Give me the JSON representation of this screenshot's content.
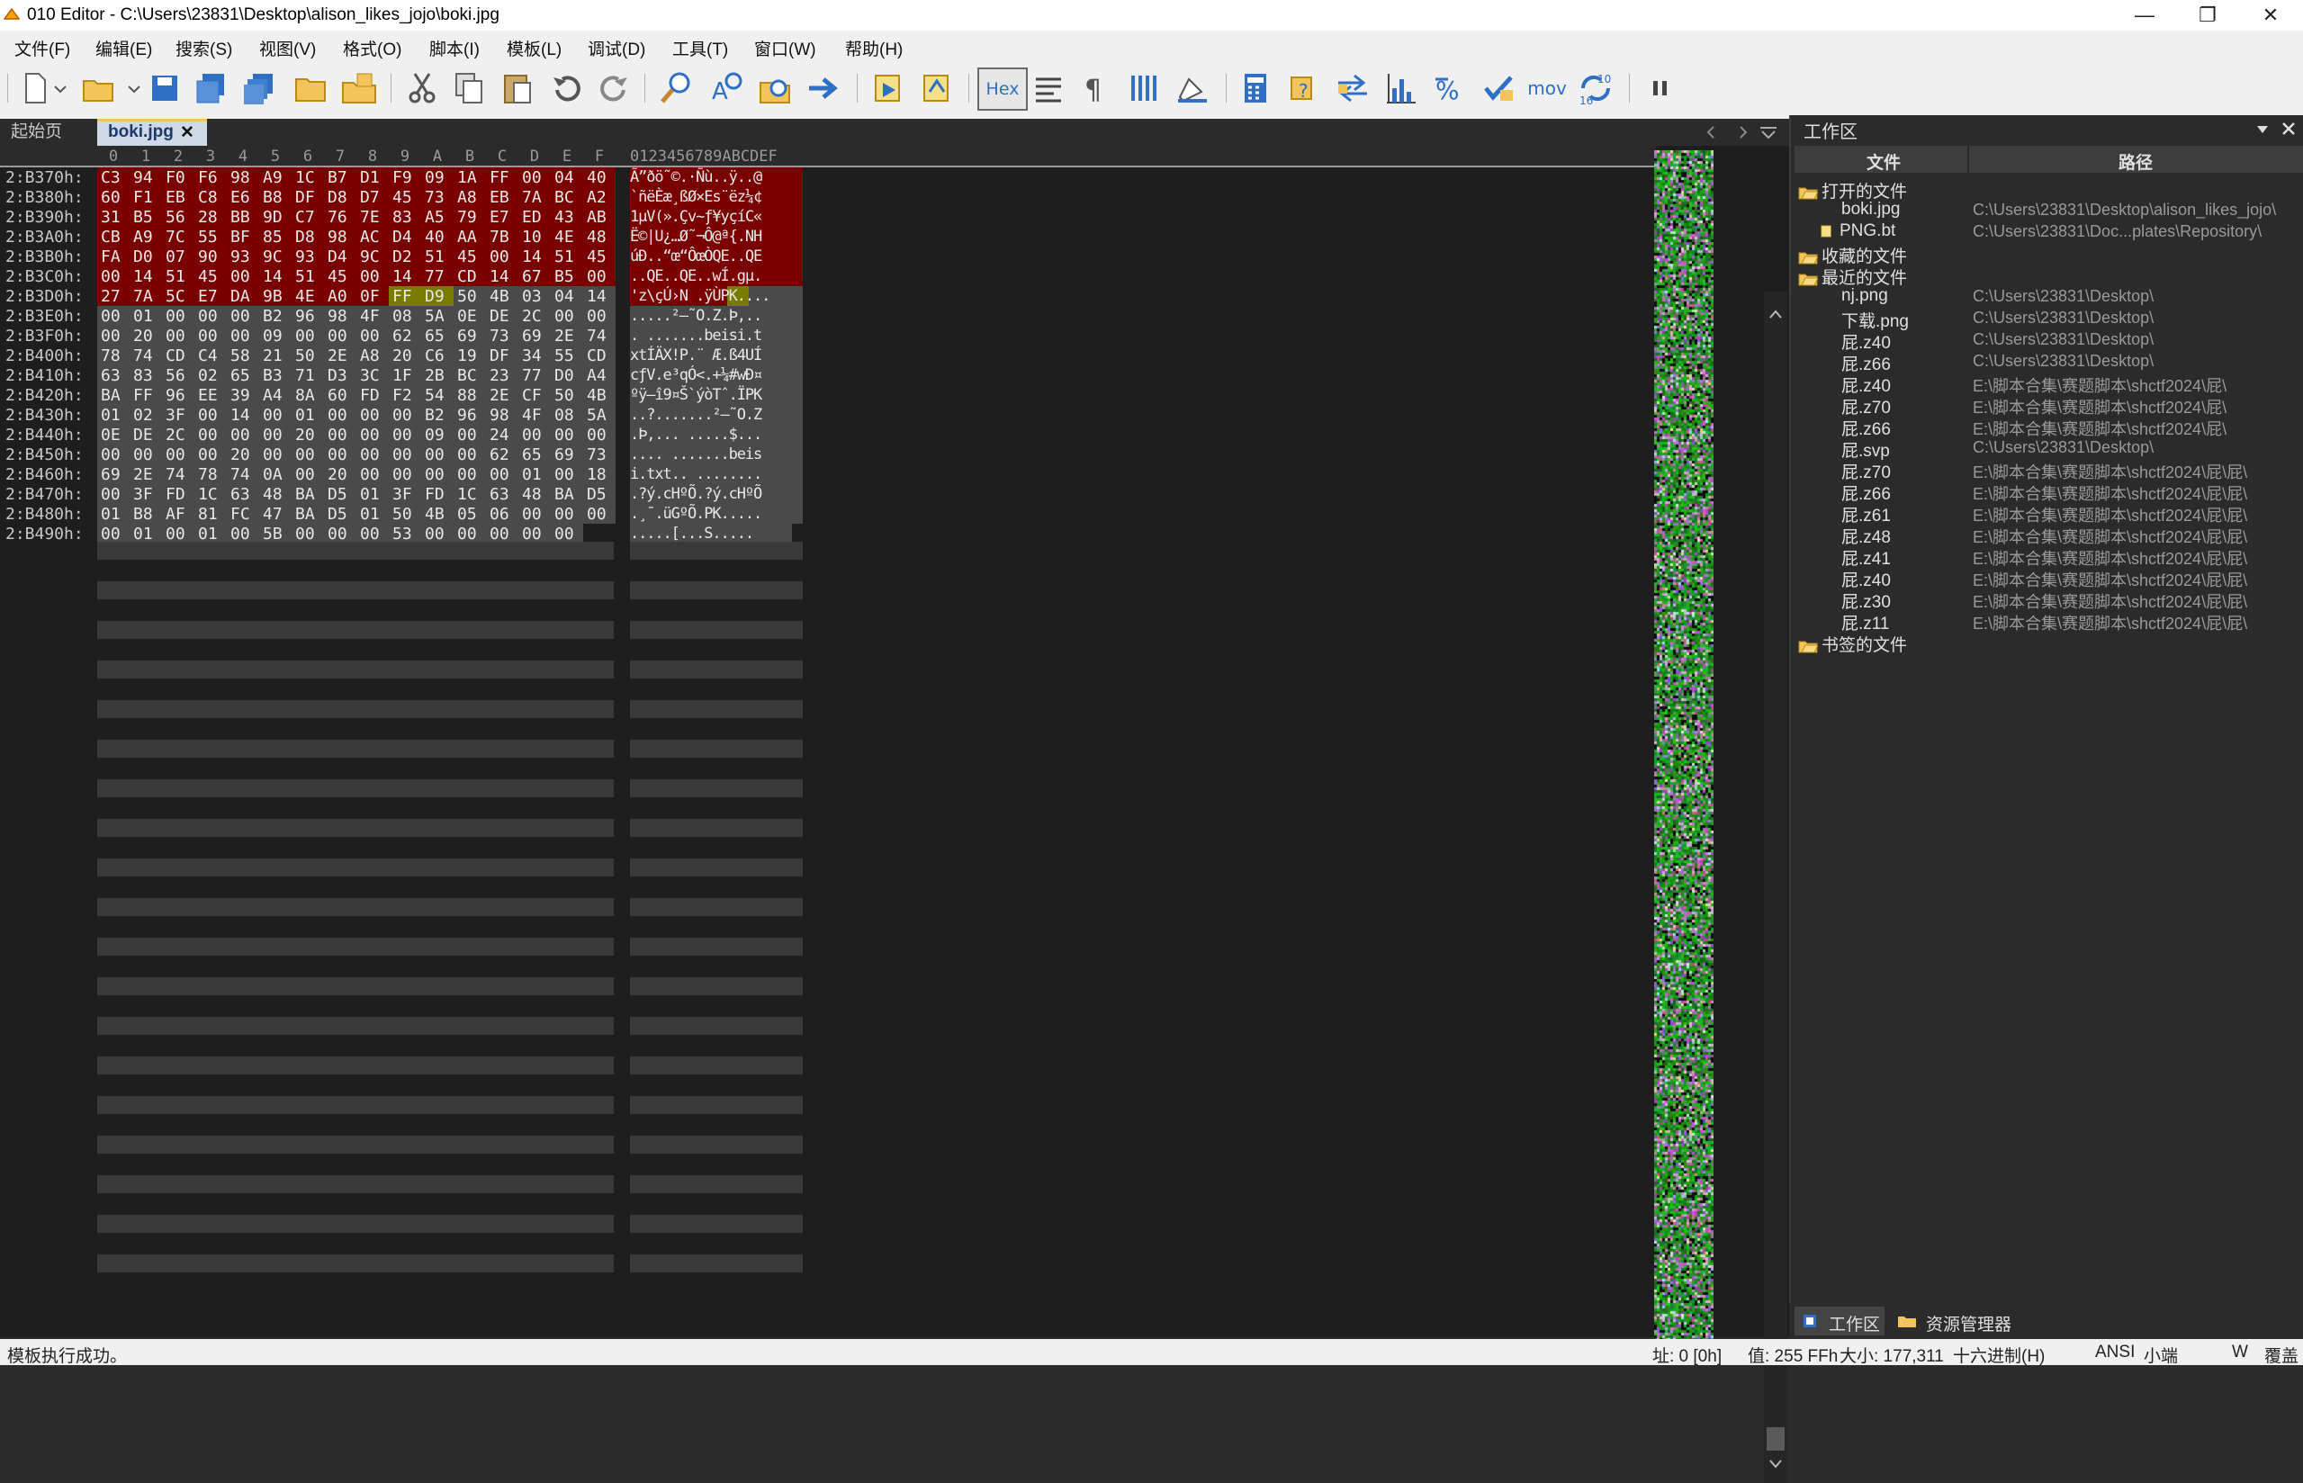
{
  "window": {
    "title": "010 Editor - C:\\Users\\23831\\Desktop\\alison_likes_jojo\\boki.jpg",
    "minimize": "—",
    "maximize": "❐",
    "close": "✕"
  },
  "menu": [
    "文件(F)",
    "编辑(E)",
    "搜索(S)",
    "视图(V)",
    "格式(O)",
    "脚本(I)",
    "模板(L)",
    "调试(D)",
    "工具(T)",
    "窗口(W)",
    "帮助(H)"
  ],
  "toolbar": {
    "hex_label": "Hex",
    "mov_label": "mov",
    "base_top": "10",
    "base_bottom": "16"
  },
  "tabs": {
    "start": "起始页",
    "file": "boki.jpg",
    "close": "✕"
  },
  "hex_columns": [
    "0",
    "1",
    "2",
    "3",
    "4",
    "5",
    "6",
    "7",
    "8",
    "9",
    "A",
    "B",
    "C",
    "D",
    "E",
    "F"
  ],
  "ascii_header": "0123456789ABCDEF",
  "hex_rows": [
    {
      "addr": "2:B370h:",
      "bytes": [
        "C3",
        "94",
        "F0",
        "F6",
        "98",
        "A9",
        "1C",
        "B7",
        "D1",
        "F9",
        "09",
        "1A",
        "FF",
        "00",
        "04",
        "40"
      ],
      "ascii": "Ã”ðö˜©.·Ñù..ÿ..@"
    },
    {
      "addr": "2:B380h:",
      "bytes": [
        "60",
        "F1",
        "EB",
        "C8",
        "E6",
        "B8",
        "DF",
        "D8",
        "D7",
        "45",
        "73",
        "A8",
        "EB",
        "7A",
        "BC",
        "A2"
      ],
      "ascii": "`ñëÈæ¸ßØ×Es¨ëz¼¢"
    },
    {
      "addr": "2:B390h:",
      "bytes": [
        "31",
        "B5",
        "56",
        "28",
        "BB",
        "9D",
        "C7",
        "76",
        "7E",
        "83",
        "A5",
        "79",
        "E7",
        "ED",
        "43",
        "AB"
      ],
      "ascii": "1µV(».Çv~ƒ¥yçíC«"
    },
    {
      "addr": "2:B3A0h:",
      "bytes": [
        "CB",
        "A9",
        "7C",
        "55",
        "BF",
        "85",
        "D8",
        "98",
        "AC",
        "D4",
        "40",
        "AA",
        "7B",
        "10",
        "4E",
        "48"
      ],
      "ascii": "Ë©|U¿…Ø˜¬Ô@ª{.NH"
    },
    {
      "addr": "2:B3B0h:",
      "bytes": [
        "FA",
        "D0",
        "07",
        "90",
        "93",
        "9C",
        "93",
        "D4",
        "9C",
        "D2",
        "51",
        "45",
        "00",
        "14",
        "51",
        "45"
      ],
      "ascii": "úÐ..“œ“ÔœÒQE..QE"
    },
    {
      "addr": "2:B3C0h:",
      "bytes": [
        "00",
        "14",
        "51",
        "45",
        "00",
        "14",
        "51",
        "45",
        "00",
        "14",
        "77",
        "CD",
        "14",
        "67",
        "B5",
        "00"
      ],
      "ascii": "..QE..QE..wÍ.gµ."
    },
    {
      "addr": "2:B3D0h:",
      "bytes": [
        "27",
        "7A",
        "5C",
        "E7",
        "DA",
        "9B",
        "4E",
        "A0",
        "0F",
        "FF",
        "D9",
        "50",
        "4B",
        "03",
        "04",
        "14"
      ],
      "ascii": "'z\\çÚ›N .ÿÙPK...."
    },
    {
      "addr": "2:B3E0h:",
      "bytes": [
        "00",
        "01",
        "00",
        "00",
        "00",
        "B2",
        "96",
        "98",
        "4F",
        "08",
        "5A",
        "0E",
        "DE",
        "2C",
        "00",
        "00"
      ],
      "ascii": ".....²–˜O.Z.Þ,.."
    },
    {
      "addr": "2:B3F0h:",
      "bytes": [
        "00",
        "20",
        "00",
        "00",
        "00",
        "09",
        "00",
        "00",
        "00",
        "62",
        "65",
        "69",
        "73",
        "69",
        "2E",
        "74"
      ],
      "ascii": ". .......beisi.t"
    },
    {
      "addr": "2:B400h:",
      "bytes": [
        "78",
        "74",
        "CD",
        "C4",
        "58",
        "21",
        "50",
        "2E",
        "A8",
        "20",
        "C6",
        "19",
        "DF",
        "34",
        "55",
        "CD"
      ],
      "ascii": "xtÍÄX!P.¨ Æ.ß4UÍ"
    },
    {
      "addr": "2:B410h:",
      "bytes": [
        "63",
        "83",
        "56",
        "02",
        "65",
        "B3",
        "71",
        "D3",
        "3C",
        "1F",
        "2B",
        "BC",
        "23",
        "77",
        "D0",
        "A4"
      ],
      "ascii": "cƒV.e³qÓ<.+¼#wÐ¤"
    },
    {
      "addr": "2:B420h:",
      "bytes": [
        "BA",
        "FF",
        "96",
        "EE",
        "39",
        "A4",
        "8A",
        "60",
        "FD",
        "F2",
        "54",
        "88",
        "2E",
        "CF",
        "50",
        "4B"
      ],
      "ascii": "ºÿ–î9¤Š`ýòTˆ.ÏPK"
    },
    {
      "addr": "2:B430h:",
      "bytes": [
        "01",
        "02",
        "3F",
        "00",
        "14",
        "00",
        "01",
        "00",
        "00",
        "00",
        "B2",
        "96",
        "98",
        "4F",
        "08",
        "5A"
      ],
      "ascii": "..?.......²–˜O.Z"
    },
    {
      "addr": "2:B440h:",
      "bytes": [
        "0E",
        "DE",
        "2C",
        "00",
        "00",
        "00",
        "20",
        "00",
        "00",
        "00",
        "09",
        "00",
        "24",
        "00",
        "00",
        "00"
      ],
      "ascii": ".Þ,... .....$..."
    },
    {
      "addr": "2:B450h:",
      "bytes": [
        "00",
        "00",
        "00",
        "00",
        "20",
        "00",
        "00",
        "00",
        "00",
        "00",
        "00",
        "00",
        "62",
        "65",
        "69",
        "73"
      ],
      "ascii": ".... .......beis"
    },
    {
      "addr": "2:B460h:",
      "bytes": [
        "69",
        "2E",
        "74",
        "78",
        "74",
        "0A",
        "00",
        "20",
        "00",
        "00",
        "00",
        "00",
        "00",
        "01",
        "00",
        "18"
      ],
      "ascii": "i.txt.. ........"
    },
    {
      "addr": "2:B470h:",
      "bytes": [
        "00",
        "3F",
        "FD",
        "1C",
        "63",
        "48",
        "BA",
        "D5",
        "01",
        "3F",
        "FD",
        "1C",
        "63",
        "48",
        "BA",
        "D5"
      ],
      "ascii": ".?ý.cHºÕ.?ý.cHºÕ"
    },
    {
      "addr": "2:B480h:",
      "bytes": [
        "01",
        "B8",
        "AF",
        "81",
        "FC",
        "47",
        "BA",
        "D5",
        "01",
        "50",
        "4B",
        "05",
        "06",
        "00",
        "00",
        "00"
      ],
      "ascii": ".¸¯.üGºÕ.PK....."
    },
    {
      "addr": "2:B490h:",
      "bytes": [
        "00",
        "01",
        "00",
        "01",
        "00",
        "5B",
        "00",
        "00",
        "00",
        "53",
        "00",
        "00",
        "00",
        "00",
        "00"
      ],
      "ascii": ".....[...S....."
    }
  ],
  "colors": {
    "highlight_red": "#7a0000",
    "highlight_olive": "#7a7a00",
    "selection_gray": "#4a4a4a",
    "accent_blue": "#1e6fc2"
  },
  "workspace": {
    "title": "工作区",
    "col_file": "文件",
    "col_path": "路径",
    "open_files_label": "打开的文件",
    "open_files": [
      {
        "name": "boki.jpg",
        "path": "C:\\Users\\23831\\Desktop\\alison_likes_jojo\\"
      },
      {
        "name": "PNG.bt",
        "path": "C:\\Users\\23831\\Doc...plates\\Repository\\"
      }
    ],
    "favorites_label": "收藏的文件",
    "recent_label": "最近的文件",
    "recent_files": [
      {
        "name": "nj.png",
        "path": "C:\\Users\\23831\\Desktop\\"
      },
      {
        "name": "下载.png",
        "path": "C:\\Users\\23831\\Desktop\\"
      },
      {
        "name": "屁.z40",
        "path": "C:\\Users\\23831\\Desktop\\"
      },
      {
        "name": "屁.z66",
        "path": "C:\\Users\\23831\\Desktop\\"
      },
      {
        "name": "屁.z40",
        "path": "E:\\脚本合集\\赛题脚本\\shctf2024\\屁\\"
      },
      {
        "name": "屁.z70",
        "path": "E:\\脚本合集\\赛题脚本\\shctf2024\\屁\\"
      },
      {
        "name": "屁.z66",
        "path": "E:\\脚本合集\\赛题脚本\\shctf2024\\屁\\"
      },
      {
        "name": "屁.svp",
        "path": "C:\\Users\\23831\\Desktop\\"
      },
      {
        "name": "屁.z70",
        "path": "E:\\脚本合集\\赛题脚本\\shctf2024\\屁\\屁\\"
      },
      {
        "name": "屁.z66",
        "path": "E:\\脚本合集\\赛题脚本\\shctf2024\\屁\\屁\\"
      },
      {
        "name": "屁.z61",
        "path": "E:\\脚本合集\\赛题脚本\\shctf2024\\屁\\屁\\"
      },
      {
        "name": "屁.z48",
        "path": "E:\\脚本合集\\赛题脚本\\shctf2024\\屁\\屁\\"
      },
      {
        "name": "屁.z41",
        "path": "E:\\脚本合集\\赛题脚本\\shctf2024\\屁\\屁\\"
      },
      {
        "name": "屁.z40",
        "path": "E:\\脚本合集\\赛题脚本\\shctf2024\\屁\\屁\\"
      },
      {
        "name": "屁.z30",
        "path": "E:\\脚本合集\\赛题脚本\\shctf2024\\屁\\屁\\"
      },
      {
        "name": "屁.z11",
        "path": "E:\\脚本合集\\赛题脚本\\shctf2024\\屁\\屁\\"
      }
    ],
    "bookmarks_label": "书签的文件",
    "tab_workspace": "工作区",
    "tab_explorer": "资源管理器"
  },
  "status": {
    "message": "模板执行成功。",
    "address": "址: 0 [0h]",
    "value": "值: 255 FFh",
    "size": "大小: 177,311",
    "mode": "十六进制(H)",
    "encoding": "ANSI",
    "endian": "小端",
    "write": "W",
    "overwrite": "覆盖"
  }
}
